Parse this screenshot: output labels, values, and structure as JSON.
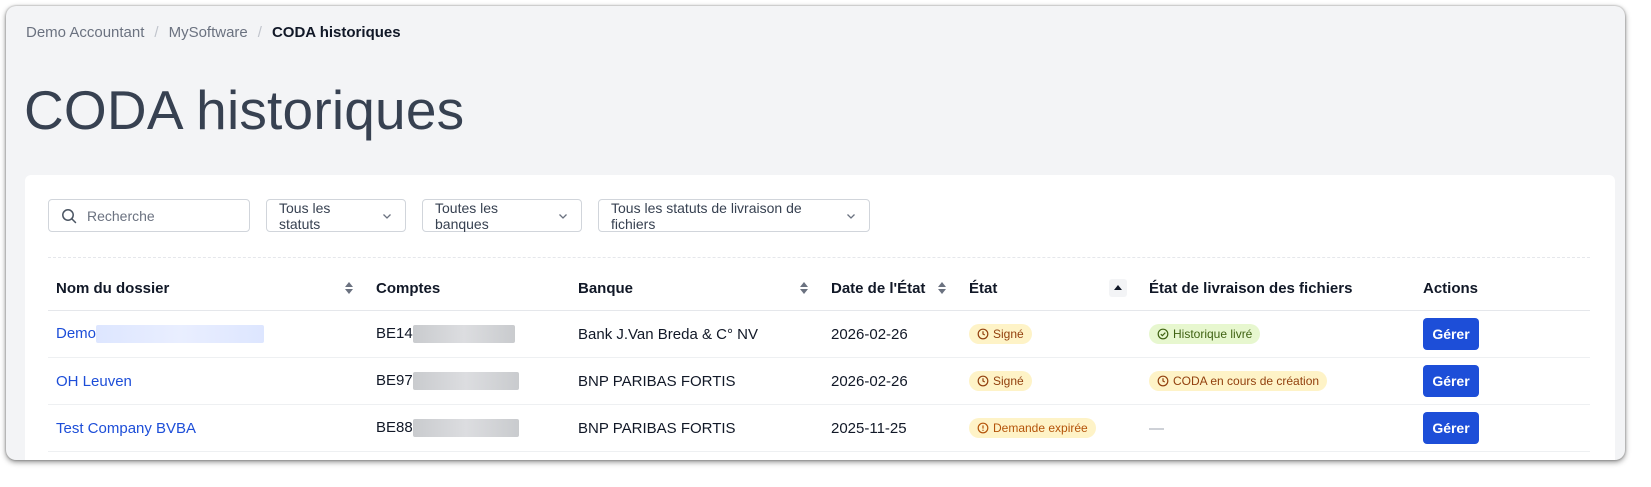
{
  "breadcrumb": {
    "items": [
      {
        "label": "Demo Accountant"
      },
      {
        "label": "MySoftware"
      },
      {
        "label": "CODA historiques"
      }
    ],
    "separator": "/"
  },
  "page": {
    "title": "CODA historiques"
  },
  "filters": {
    "search_placeholder": "Recherche",
    "status_select": "Tous les statuts",
    "bank_select": "Toutes les banques",
    "delivery_select": "Tous les statuts de livraison de fichiers"
  },
  "table": {
    "columns": {
      "name": "Nom du dossier",
      "accounts": "Comptes",
      "bank": "Banque",
      "date": "Date de l'État",
      "state": "État",
      "delivery": "État de livraison des fichiers",
      "actions": "Actions"
    },
    "rows": [
      {
        "name": "Demo",
        "account": "BE14",
        "bank": "Bank J.Van Breda & C° NV",
        "date": "2026-02-26",
        "state": "Signé",
        "delivery": "Historique livré",
        "action": "Gérer"
      },
      {
        "name": "OH Leuven",
        "account": "BE97",
        "bank": "BNP PARIBAS FORTIS",
        "date": "2026-02-26",
        "state": "Signé",
        "delivery": "CODA en cours de création",
        "action": "Gérer"
      },
      {
        "name": "Test Company BVBA",
        "account": "BE88",
        "bank": "BNP PARIBAS FORTIS",
        "date": "2025-11-25",
        "state": "Demande expirée",
        "delivery": "—",
        "action": "Gérer"
      }
    ]
  },
  "colors": {
    "primary": "#1d4ed8",
    "badge_yellow_bg": "#fef3c7",
    "badge_green_bg": "#e7f7cf"
  }
}
